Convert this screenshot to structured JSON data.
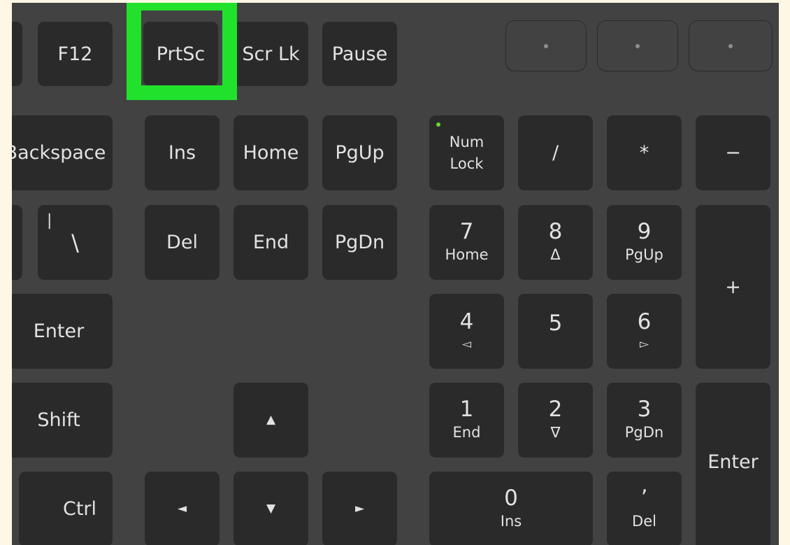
{
  "highlight_color": "#21e12d",
  "function_row": {
    "f12": "F12",
    "prtsc": "PrtSc",
    "scrlk": "Scr Lk",
    "pause": "Pause"
  },
  "nav": {
    "backspace": "Backspace",
    "ins": "Ins",
    "home": "Home",
    "pgup": "PgUp",
    "pipe": "|",
    "backslash": "\\",
    "del": "Del",
    "end": "End",
    "pgdn": "PgDn",
    "enter": "Enter",
    "shift": "Shift",
    "ctrl": "Ctrl",
    "arrow_up": "▲",
    "arrow_left": "◄",
    "arrow_down": "▼",
    "arrow_right": "►"
  },
  "numpad": {
    "numlock_line1": "Num",
    "numlock_line2": "Lock",
    "divide": "/",
    "multiply": "*",
    "minus": "−",
    "plus": "+",
    "enter": "Enter",
    "k7": "7",
    "k7_sub": "Home",
    "k8": "8",
    "k8_sub": "Δ",
    "k9": "9",
    "k9_sub": "PgUp",
    "k4": "4",
    "k4_sub": "◅",
    "k5": "5",
    "k6": "6",
    "k6_sub": "▻",
    "k1": "1",
    "k1_sub": "End",
    "k2": "2",
    "k2_sub": "∇",
    "k3": "3",
    "k3_sub": "PgDn",
    "k0": "0",
    "k0_sub": "Ins",
    "dec": "ʼ",
    "dec_sub": "Del"
  }
}
